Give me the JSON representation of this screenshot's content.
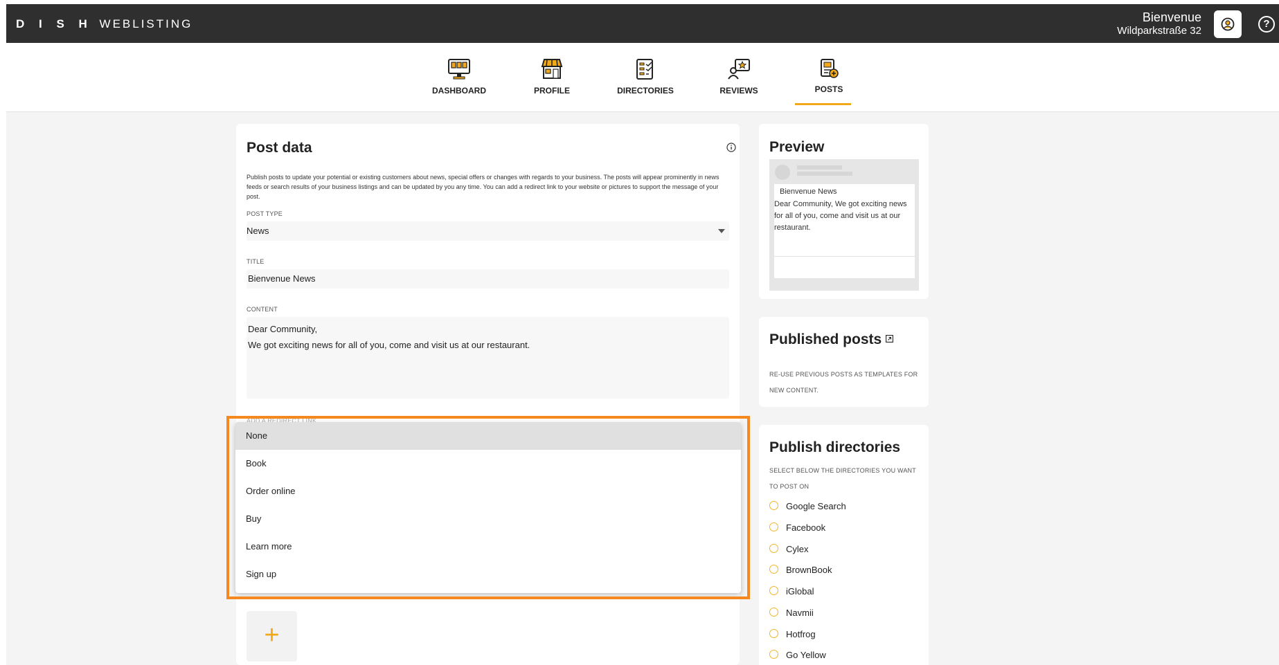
{
  "topbar": {
    "brand_bold": "D I S H",
    "brand_light": "WEBLISTING",
    "user_name": "Bienvenue",
    "user_address": "Wildparkstraße 32",
    "help_label": "?"
  },
  "nav": {
    "items": [
      {
        "label": "DASHBOARD",
        "icon": "dashboard-icon"
      },
      {
        "label": "PROFILE",
        "icon": "store-icon"
      },
      {
        "label": "DIRECTORIES",
        "icon": "directories-icon"
      },
      {
        "label": "REVIEWS",
        "icon": "reviews-icon"
      },
      {
        "label": "POSTS",
        "icon": "posts-icon"
      }
    ],
    "active": "POSTS"
  },
  "post_data": {
    "title": "Post data",
    "description": "Publish posts to update your potential or existing customers about news, special offers or changes with regards to your business. The posts will appear prominently in news feeds or search results of your business listings and can be updated by you any time. You can add a redirect link to your website or pictures to support the message of your post.",
    "post_type_label": "POST TYPE",
    "post_type_value": "News",
    "title_label": "TITLE",
    "title_value": "Bienvenue News",
    "content_label": "CONTENT",
    "content_line1": "Dear Community,",
    "content_line2": "We got exciting news for all of you, come and visit us at our restaurant.",
    "redirect_label": "ADD A REDIRECT LINK",
    "add_button": "+"
  },
  "dropdown": {
    "options": [
      "None",
      "Book",
      "Order online",
      "Buy",
      "Learn more",
      "Sign up"
    ],
    "selected": "None"
  },
  "preview": {
    "title": "Preview",
    "post_title": "Bienvenue News",
    "post_text": "Dear Community, We got exciting news for all of you, come and visit us at our restaurant."
  },
  "published": {
    "title": "Published posts",
    "subtitle_line1": "RE-USE PREVIOUS POSTS AS TEMPLATES FOR",
    "subtitle_line2": "NEW CONTENT."
  },
  "publish_directories": {
    "title": "Publish directories",
    "subtitle_line1": "SELECT BELOW THE DIRECTORIES YOU WANT",
    "subtitle_line2": "TO POST ON",
    "items": [
      "Google Search",
      "Facebook",
      "Cylex",
      "BrownBook",
      "iGlobal",
      "Navmii",
      "Hotfrog",
      "Go Yellow"
    ]
  },
  "colors": {
    "accent": "#f3a81a",
    "highlight": "#f5891f",
    "topbar": "#2f2f2f"
  }
}
